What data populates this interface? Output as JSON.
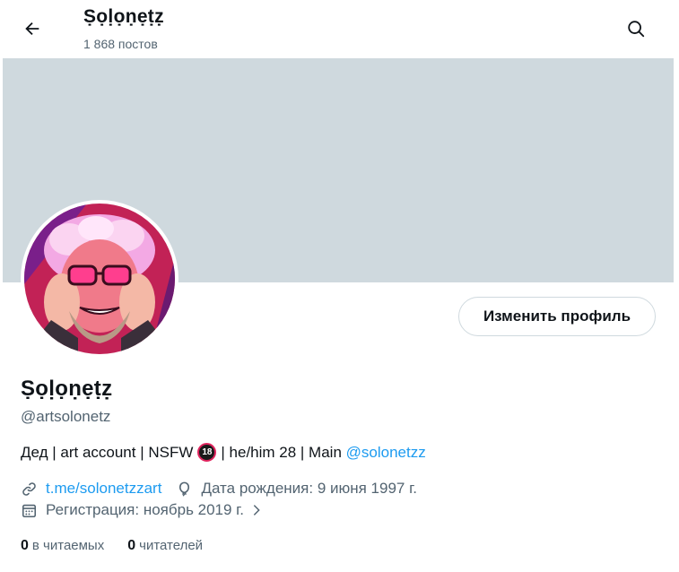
{
  "header": {
    "title": "Ṣọḷọṇẹṭẓ",
    "post_count": "1 868 постов",
    "back_icon": "arrow-left-icon",
    "search_icon": "search-icon"
  },
  "profile": {
    "edit_button": "Изменить профиль",
    "display_name": "Ṣọḷọṇẹṭẓ",
    "handle": "@artsolonetz",
    "bio_text": "Дед | art account | NSFW",
    "bio_badge": "18",
    "bio_text2": "| he/him 28 | Main",
    "bio_mention": "@solonetzz",
    "link": "t.me/solonetzzart",
    "birthday": "Дата рождения: 9 июня 1997 г.",
    "joined": "Регистрация: ноябрь 2019 г.",
    "following_count": "0",
    "following_label": "в читаемых",
    "followers_count": "0",
    "followers_label": "читателей"
  },
  "colors": {
    "banner": "#cfd9de",
    "link": "#1d9bf0",
    "secondary_text": "#536471"
  }
}
